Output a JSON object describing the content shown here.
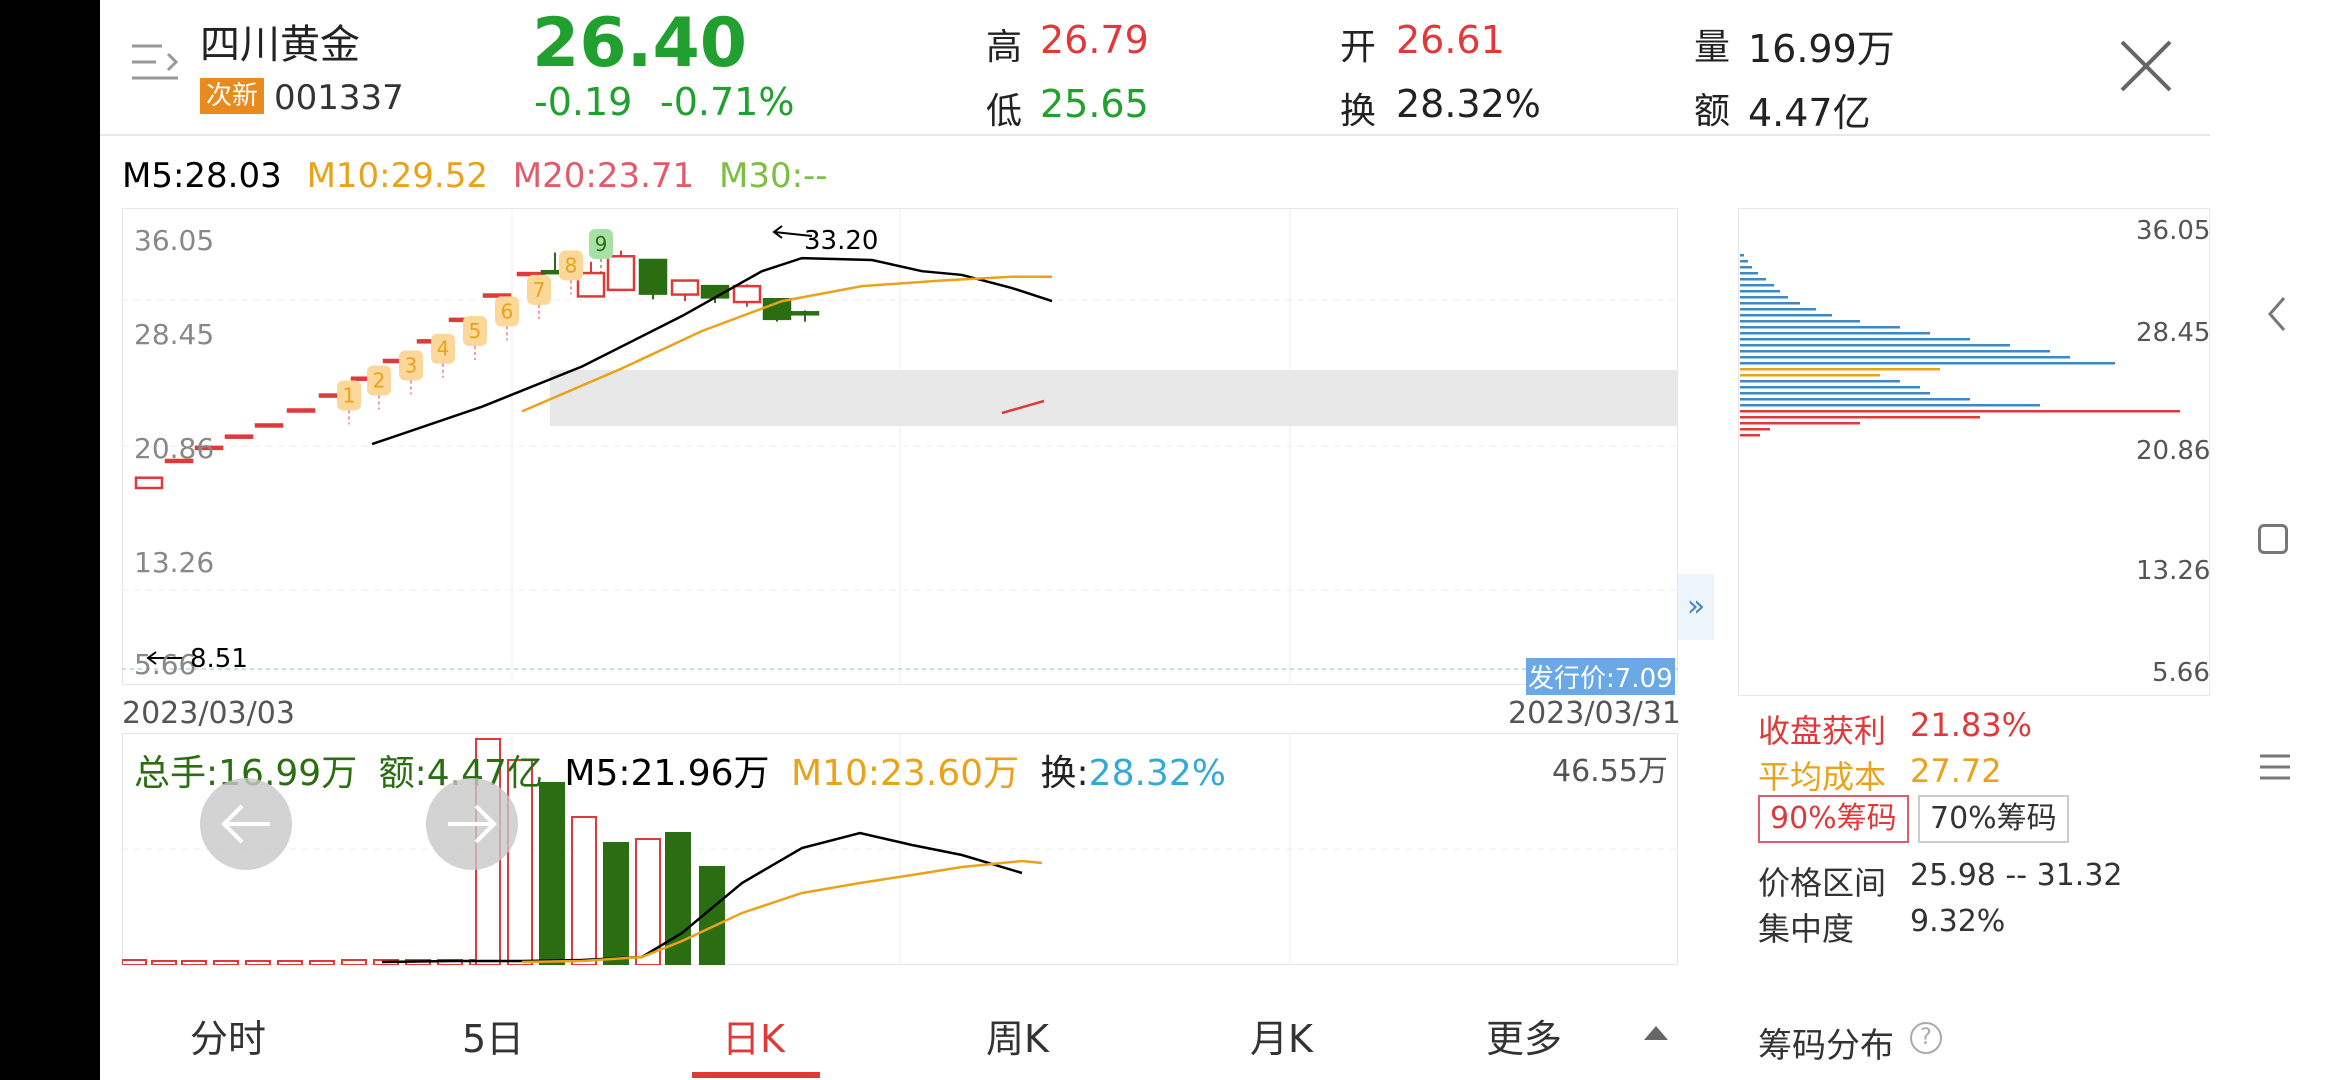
{
  "stock": {
    "name": "四川黄金",
    "badge": "次新",
    "code": "001337",
    "price": "26.40",
    "change": "-0.19",
    "change_pct": "-0.71%"
  },
  "stats": {
    "high_label": "高",
    "high_value": "26.79",
    "open_label": "开",
    "open_value": "26.61",
    "vol_label": "量",
    "vol_value": "16.99万",
    "low_label": "低",
    "low_value": "25.65",
    "turnover_label": "换",
    "turnover_value": "28.32%",
    "amount_label": "额",
    "amount_value": "4.47亿"
  },
  "ma": {
    "m5": "M5:28.03",
    "m10": "M10:29.52",
    "m20": "M20:23.71",
    "m30": "M30:--"
  },
  "price_chart": {
    "y_ticks": [
      "36.05",
      "28.45",
      "20.86",
      "13.26",
      "5.66"
    ],
    "high_marker": "33.20",
    "low_marker": "8.51",
    "ipo_price": "发行价:7.09",
    "date_start": "2023/03/03",
    "date_end": "2023/03/31",
    "seq_labels": [
      "1",
      "2",
      "3",
      "4",
      "5",
      "6",
      "7",
      "8",
      "9"
    ]
  },
  "volume": {
    "total": "总手:16.99万",
    "amount": "额:4.47亿",
    "m5": "M5:21.96万",
    "m10": "M10:23.60万",
    "turnover_label": "换:",
    "turnover_value": "28.32%",
    "max_label": "46.55万"
  },
  "chip": {
    "y_ticks": [
      "36.05",
      "28.45",
      "20.86",
      "13.26",
      "5.66"
    ],
    "profit_label": "收盘获利",
    "profit_value": "21.83%",
    "avg_label": "平均成本",
    "avg_value": "27.72",
    "btn_90": "90%筹码",
    "btn_70": "70%筹码",
    "range_label": "价格区间",
    "range_value": "25.98 -- 31.32",
    "conc_label": "集中度",
    "conc_value": "9.32%",
    "title": "筹码分布"
  },
  "tabs": [
    "分时",
    "5日",
    "日K",
    "周K",
    "月K",
    "更多"
  ],
  "active_tab": "日K",
  "colors": {
    "up": "#e0393a",
    "down": "#2b6e12",
    "ma5": "#000000",
    "ma10": "#e9a21a",
    "ma20": "#e05c6b",
    "ma30": "#7bc043",
    "turnover": "#35a9d6",
    "ipo_bg": "#6aa9e6"
  },
  "icons": [
    "menu-toggle-icon",
    "close-icon",
    "expand-right-icon",
    "arrow-left-icon",
    "arrow-right-icon",
    "caret-up-icon",
    "help-icon",
    "back-icon",
    "home-icon",
    "recents-icon"
  ]
}
